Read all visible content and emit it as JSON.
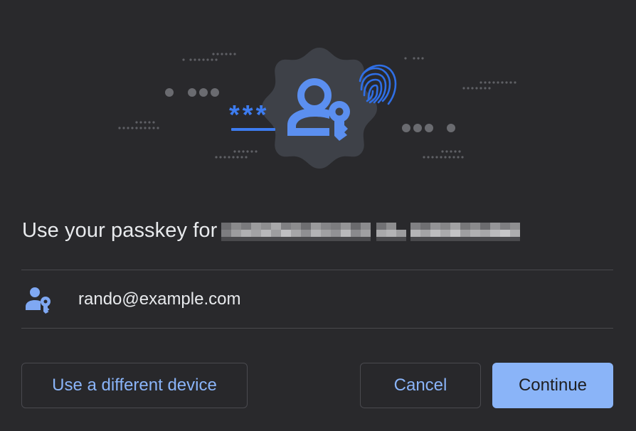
{
  "dialog": {
    "title": "Use your passkey for",
    "site_redacted": true
  },
  "account": {
    "icon": "person-key-icon",
    "email": "rando@example.com"
  },
  "buttons": {
    "different_device": "Use a different device",
    "cancel": "Cancel",
    "continue": "Continue"
  },
  "illustration": {
    "password_glyphs": "***",
    "icons": [
      "passkey-badge-icon",
      "person-key-icon",
      "fingerprint-icon"
    ]
  },
  "colors": {
    "background": "#29292c",
    "accent": "#8ab4f8",
    "icon_blue": "#5b8ff0",
    "badge": "#3e4148",
    "text": "#e8eaed"
  }
}
